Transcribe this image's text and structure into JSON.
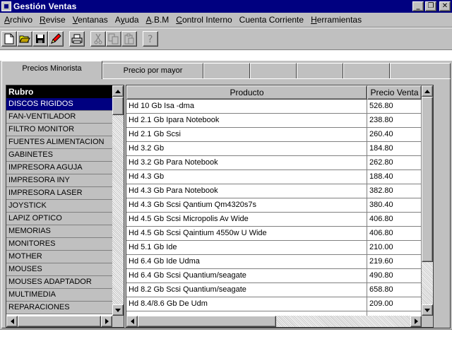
{
  "window": {
    "title": "Gestión Ventas",
    "buttons": [
      "minimize",
      "restore",
      "close"
    ]
  },
  "menu": [
    {
      "label": "Archivo",
      "accel": "A"
    },
    {
      "label": "Revise",
      "accel": "R"
    },
    {
      "label": "Ventanas",
      "accel": "V"
    },
    {
      "label": "Ayuda",
      "accel": "y"
    },
    {
      "label": "A.B.M",
      "accel": "A"
    },
    {
      "label": "Control Interno",
      "accel": "C"
    },
    {
      "label": "Cuenta Corriente",
      "accel": ""
    },
    {
      "label": "Herramientas",
      "accel": "H"
    }
  ],
  "toolbar": {
    "icons": [
      "new-document-icon",
      "open-folder-icon",
      "save-disk-icon",
      "pencil-icon",
      "print-icon",
      "cut-icon",
      "copy-icon",
      "paste-icon",
      "help-icon"
    ]
  },
  "tabs": [
    {
      "label": "Precios Minorista",
      "active": true
    },
    {
      "label": "Precio por mayor",
      "active": false
    },
    {
      "label": "",
      "active": false
    },
    {
      "label": "",
      "active": false
    },
    {
      "label": "",
      "active": false
    },
    {
      "label": "",
      "active": false
    },
    {
      "label": "",
      "active": false
    }
  ],
  "rubro": {
    "header": "Rubro",
    "selected_index": 0,
    "items": [
      "DISCOS RIGIDOS",
      "FAN-VENTILADOR",
      "FILTRO MONITOR",
      "FUENTES ALIMENTACION",
      "GABINETES",
      "IMPRESORA AGUJA",
      "IMPRESORA INY",
      "IMPRESORA LASER",
      "JOYSTICK",
      "LAPIZ OPTICO",
      "MEMORIAS",
      "MONITORES",
      "MOTHER",
      "MOUSES",
      "MOUSES ADAPTADOR",
      "MULTIMEDIA",
      "REPARACIONES"
    ]
  },
  "products": {
    "columns": [
      "Producto",
      "Precio Venta"
    ],
    "rows": [
      [
        "Hd 10 Gb  Isa -dma",
        "526.80"
      ],
      [
        "Hd  2.1 Gb Ipara Notebook",
        "238.80"
      ],
      [
        "Hd  2.1 Gb Scsi",
        "260.40"
      ],
      [
        "Hd  3.2 Gb",
        "184.80"
      ],
      [
        "Hd  3.2 Gb Para Notebook",
        "262.80"
      ],
      [
        "Hd  4.3 Gb",
        "188.40"
      ],
      [
        "Hd  4.3 Gb  Para Notebook",
        "382.80"
      ],
      [
        "Hd  4.3 Gb  Scsi Qantium Qm4320s7s",
        "380.40"
      ],
      [
        "Hd 4.5 Gb Scsi Micropolis Av Wide",
        "406.80"
      ],
      [
        "Hd 4.5 Gb Scsi Qaintium 4550w U Wide",
        "406.80"
      ],
      [
        "Hd 5.1  Gb Ide",
        "210.00"
      ],
      [
        "Hd 6.4   Gb Ide Udma",
        "219.60"
      ],
      [
        "Hd 6.4   Gb Scsi Quantium/seagate",
        "490.80"
      ],
      [
        "Hd 8.2  Gb Scsi Quantium/seagate",
        "658.80"
      ],
      [
        "Hd 8.4/8.6 Gb De Udm",
        "209.00"
      ],
      [
        "",
        ""
      ]
    ]
  }
}
